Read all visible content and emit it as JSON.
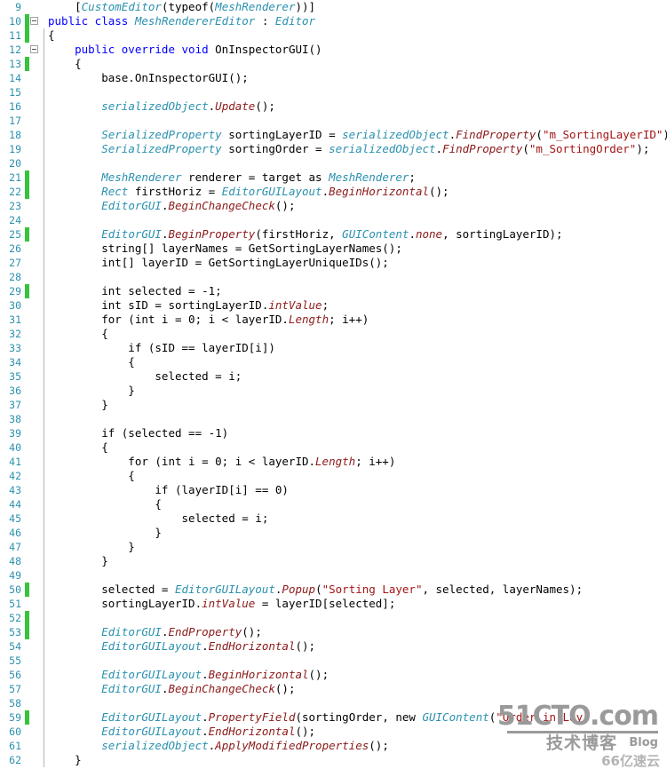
{
  "editor": {
    "language": "csharp",
    "first_line_number": 9,
    "colors": {
      "background": "#ffffff",
      "line_number": "#2b91af",
      "keyword": "#0000ff",
      "type": "#2b91af",
      "method": "#8b1a1a",
      "string": "#a31515",
      "plain": "#000000",
      "change_bar": "#36c43d",
      "indent_guide": "#b4b4b4"
    },
    "lines": [
      {
        "num": 9,
        "changed": false,
        "fold": "none",
        "guide": false,
        "tokens": [
          {
            "t": "    [",
            "c": "pln"
          },
          {
            "t": "CustomEditor",
            "c": "typ"
          },
          {
            "t": "(typeof(",
            "c": "pln"
          },
          {
            "t": "MeshRenderer",
            "c": "typ"
          },
          {
            "t": "))]",
            "c": "pln"
          }
        ]
      },
      {
        "num": 10,
        "changed": true,
        "fold": "open",
        "guide": false,
        "tokens": [
          {
            "t": "public class ",
            "c": "kw2"
          },
          {
            "t": "MeshRendererEditor",
            "c": "typ2"
          },
          {
            "t": " : ",
            "c": "pln"
          },
          {
            "t": "Editor",
            "c": "typ"
          }
        ]
      },
      {
        "num": 11,
        "changed": true,
        "fold": "none",
        "guide": true,
        "tokens": [
          {
            "t": "{",
            "c": "pln"
          }
        ]
      },
      {
        "num": 12,
        "changed": false,
        "fold": "open",
        "guide": true,
        "tokens": [
          {
            "t": "    public override void ",
            "c": "kw2"
          },
          {
            "t": "OnInspectorGUI()",
            "c": "pln2"
          }
        ]
      },
      {
        "num": 13,
        "changed": true,
        "fold": "none",
        "guide": true,
        "tokens": [
          {
            "t": "    {",
            "c": "pln"
          }
        ]
      },
      {
        "num": 14,
        "changed": false,
        "fold": "none",
        "guide": true,
        "tokens": [
          {
            "t": "        base.OnInspectorGUI();",
            "c": "pln"
          }
        ]
      },
      {
        "num": 15,
        "changed": false,
        "fold": "none",
        "guide": true,
        "tokens": []
      },
      {
        "num": 16,
        "changed": false,
        "fold": "none",
        "guide": true,
        "tokens": [
          {
            "t": "        ",
            "c": "pln"
          },
          {
            "t": "serializedObject",
            "c": "obj"
          },
          {
            "t": ".",
            "c": "pln"
          },
          {
            "t": "Update",
            "c": "mth"
          },
          {
            "t": "();",
            "c": "pln"
          }
        ]
      },
      {
        "num": 17,
        "changed": false,
        "fold": "none",
        "guide": true,
        "tokens": []
      },
      {
        "num": 18,
        "changed": false,
        "fold": "none",
        "guide": true,
        "tokens": [
          {
            "t": "        ",
            "c": "pln"
          },
          {
            "t": "SerializedProperty",
            "c": "typ"
          },
          {
            "t": " sortingLayerID = ",
            "c": "pln"
          },
          {
            "t": "serializedObject",
            "c": "obj"
          },
          {
            "t": ".",
            "c": "pln"
          },
          {
            "t": "FindProperty",
            "c": "mth"
          },
          {
            "t": "(",
            "c": "pln"
          },
          {
            "t": "\"m_SortingLayerID\"",
            "c": "str"
          },
          {
            "t": ");",
            "c": "pln"
          }
        ]
      },
      {
        "num": 19,
        "changed": false,
        "fold": "none",
        "guide": true,
        "tokens": [
          {
            "t": "        ",
            "c": "pln"
          },
          {
            "t": "SerializedProperty",
            "c": "typ"
          },
          {
            "t": " sortingOrder = ",
            "c": "pln"
          },
          {
            "t": "serializedObject",
            "c": "obj"
          },
          {
            "t": ".",
            "c": "pln"
          },
          {
            "t": "FindProperty",
            "c": "mth"
          },
          {
            "t": "(",
            "c": "pln"
          },
          {
            "t": "\"m_SortingOrder\"",
            "c": "str"
          },
          {
            "t": ");",
            "c": "pln"
          }
        ]
      },
      {
        "num": 20,
        "changed": false,
        "fold": "none",
        "guide": true,
        "tokens": []
      },
      {
        "num": 21,
        "changed": true,
        "fold": "none",
        "guide": true,
        "tokens": [
          {
            "t": "        ",
            "c": "pln"
          },
          {
            "t": "MeshRenderer",
            "c": "typ"
          },
          {
            "t": " renderer = target as ",
            "c": "pln"
          },
          {
            "t": "MeshRenderer",
            "c": "typ"
          },
          {
            "t": ";",
            "c": "pln"
          }
        ]
      },
      {
        "num": 22,
        "changed": true,
        "fold": "none",
        "guide": true,
        "tokens": [
          {
            "t": "        ",
            "c": "pln"
          },
          {
            "t": "Rect",
            "c": "typ"
          },
          {
            "t": " firstHoriz = ",
            "c": "pln"
          },
          {
            "t": "EditorGUILayout",
            "c": "typ"
          },
          {
            "t": ".",
            "c": "pln"
          },
          {
            "t": "BeginHorizontal",
            "c": "mth"
          },
          {
            "t": "();",
            "c": "pln"
          }
        ]
      },
      {
        "num": 23,
        "changed": false,
        "fold": "none",
        "guide": true,
        "tokens": [
          {
            "t": "        ",
            "c": "pln"
          },
          {
            "t": "EditorGUI",
            "c": "typ"
          },
          {
            "t": ".",
            "c": "pln"
          },
          {
            "t": "BeginChangeCheck",
            "c": "mth"
          },
          {
            "t": "();",
            "c": "pln"
          }
        ]
      },
      {
        "num": 24,
        "changed": false,
        "fold": "none",
        "guide": true,
        "tokens": []
      },
      {
        "num": 25,
        "changed": true,
        "fold": "none",
        "guide": true,
        "tokens": [
          {
            "t": "        ",
            "c": "pln"
          },
          {
            "t": "EditorGUI",
            "c": "typ"
          },
          {
            "t": ".",
            "c": "pln"
          },
          {
            "t": "BeginProperty",
            "c": "mth"
          },
          {
            "t": "(firstHoriz, ",
            "c": "pln"
          },
          {
            "t": "GUIContent",
            "c": "typ"
          },
          {
            "t": ".",
            "c": "pln"
          },
          {
            "t": "none",
            "c": "mth"
          },
          {
            "t": ", sortingLayerID);",
            "c": "pln"
          }
        ]
      },
      {
        "num": 26,
        "changed": false,
        "fold": "none",
        "guide": true,
        "tokens": [
          {
            "t": "        string[] layerNames = GetSortingLayerNames();",
            "c": "pln"
          }
        ]
      },
      {
        "num": 27,
        "changed": false,
        "fold": "none",
        "guide": true,
        "tokens": [
          {
            "t": "        int[] layerID = GetSortingLayerUniqueIDs();",
            "c": "pln"
          }
        ]
      },
      {
        "num": 28,
        "changed": false,
        "fold": "none",
        "guide": true,
        "tokens": []
      },
      {
        "num": 29,
        "changed": true,
        "fold": "none",
        "guide": true,
        "tokens": [
          {
            "t": "        int selected = -1;",
            "c": "pln"
          }
        ]
      },
      {
        "num": 30,
        "changed": false,
        "fold": "none",
        "guide": true,
        "tokens": [
          {
            "t": "        int sID = sortingLayerID.",
            "c": "pln"
          },
          {
            "t": "intValue",
            "c": "mth"
          },
          {
            "t": ";",
            "c": "pln"
          }
        ]
      },
      {
        "num": 31,
        "changed": false,
        "fold": "none",
        "guide": true,
        "tokens": [
          {
            "t": "        for (int i = 0; i < layerID.",
            "c": "pln"
          },
          {
            "t": "Length",
            "c": "mth"
          },
          {
            "t": "; i++)",
            "c": "pln"
          }
        ]
      },
      {
        "num": 32,
        "changed": false,
        "fold": "none",
        "guide": true,
        "tokens": [
          {
            "t": "        {",
            "c": "pln"
          }
        ]
      },
      {
        "num": 33,
        "changed": false,
        "fold": "none",
        "guide": true,
        "tokens": [
          {
            "t": "            if (sID == layerID[i])",
            "c": "pln"
          }
        ]
      },
      {
        "num": 34,
        "changed": false,
        "fold": "none",
        "guide": true,
        "tokens": [
          {
            "t": "            {",
            "c": "pln"
          }
        ]
      },
      {
        "num": 35,
        "changed": false,
        "fold": "none",
        "guide": true,
        "tokens": [
          {
            "t": "                selected = i;",
            "c": "pln"
          }
        ]
      },
      {
        "num": 36,
        "changed": false,
        "fold": "none",
        "guide": true,
        "tokens": [
          {
            "t": "            }",
            "c": "pln"
          }
        ]
      },
      {
        "num": 37,
        "changed": false,
        "fold": "none",
        "guide": true,
        "tokens": [
          {
            "t": "        }",
            "c": "pln"
          }
        ]
      },
      {
        "num": 38,
        "changed": false,
        "fold": "none",
        "guide": true,
        "tokens": []
      },
      {
        "num": 39,
        "changed": false,
        "fold": "none",
        "guide": true,
        "tokens": [
          {
            "t": "        if (selected == -1)",
            "c": "pln"
          }
        ]
      },
      {
        "num": 40,
        "changed": false,
        "fold": "none",
        "guide": true,
        "tokens": [
          {
            "t": "        {",
            "c": "pln"
          }
        ]
      },
      {
        "num": 41,
        "changed": false,
        "fold": "none",
        "guide": true,
        "tokens": [
          {
            "t": "            for (int i = 0; i < layerID.",
            "c": "pln"
          },
          {
            "t": "Length",
            "c": "mth"
          },
          {
            "t": "; i++)",
            "c": "pln"
          }
        ]
      },
      {
        "num": 42,
        "changed": false,
        "fold": "none",
        "guide": true,
        "tokens": [
          {
            "t": "            {",
            "c": "pln"
          }
        ]
      },
      {
        "num": 43,
        "changed": false,
        "fold": "none",
        "guide": true,
        "tokens": [
          {
            "t": "                if (layerID[i] == 0)",
            "c": "pln"
          }
        ]
      },
      {
        "num": 44,
        "changed": false,
        "fold": "none",
        "guide": true,
        "tokens": [
          {
            "t": "                {",
            "c": "pln"
          }
        ]
      },
      {
        "num": 45,
        "changed": false,
        "fold": "none",
        "guide": true,
        "tokens": [
          {
            "t": "                    selected = i;",
            "c": "pln"
          }
        ]
      },
      {
        "num": 46,
        "changed": false,
        "fold": "none",
        "guide": true,
        "tokens": [
          {
            "t": "                }",
            "c": "pln"
          }
        ]
      },
      {
        "num": 47,
        "changed": false,
        "fold": "none",
        "guide": true,
        "tokens": [
          {
            "t": "            }",
            "c": "pln"
          }
        ]
      },
      {
        "num": 48,
        "changed": false,
        "fold": "none",
        "guide": true,
        "tokens": [
          {
            "t": "        }",
            "c": "pln"
          }
        ]
      },
      {
        "num": 49,
        "changed": false,
        "fold": "none",
        "guide": true,
        "tokens": []
      },
      {
        "num": 50,
        "changed": true,
        "fold": "none",
        "guide": true,
        "tokens": [
          {
            "t": "        selected = ",
            "c": "pln"
          },
          {
            "t": "EditorGUILayout",
            "c": "typ"
          },
          {
            "t": ".",
            "c": "pln"
          },
          {
            "t": "Popup",
            "c": "mth"
          },
          {
            "t": "(",
            "c": "pln"
          },
          {
            "t": "\"Sorting Layer\"",
            "c": "str"
          },
          {
            "t": ", selected, layerNames);",
            "c": "pln"
          }
        ]
      },
      {
        "num": 51,
        "changed": false,
        "fold": "none",
        "guide": true,
        "tokens": [
          {
            "t": "        sortingLayerID.",
            "c": "pln"
          },
          {
            "t": "intValue",
            "c": "mth"
          },
          {
            "t": " = layerID[selected];",
            "c": "pln"
          }
        ]
      },
      {
        "num": 52,
        "changed": true,
        "fold": "none",
        "guide": true,
        "tokens": []
      },
      {
        "num": 53,
        "changed": true,
        "fold": "none",
        "guide": true,
        "tokens": [
          {
            "t": "        ",
            "c": "pln"
          },
          {
            "t": "EditorGUI",
            "c": "typ"
          },
          {
            "t": ".",
            "c": "pln"
          },
          {
            "t": "EndProperty",
            "c": "mth"
          },
          {
            "t": "();",
            "c": "pln"
          }
        ]
      },
      {
        "num": 54,
        "changed": false,
        "fold": "none",
        "guide": true,
        "tokens": [
          {
            "t": "        ",
            "c": "pln"
          },
          {
            "t": "EditorGUILayout",
            "c": "typ"
          },
          {
            "t": ".",
            "c": "pln"
          },
          {
            "t": "EndHorizontal",
            "c": "mth"
          },
          {
            "t": "();",
            "c": "pln"
          }
        ]
      },
      {
        "num": 55,
        "changed": false,
        "fold": "none",
        "guide": true,
        "tokens": []
      },
      {
        "num": 56,
        "changed": false,
        "fold": "none",
        "guide": true,
        "tokens": [
          {
            "t": "        ",
            "c": "pln"
          },
          {
            "t": "EditorGUILayout",
            "c": "typ"
          },
          {
            "t": ".",
            "c": "pln"
          },
          {
            "t": "BeginHorizontal",
            "c": "mth"
          },
          {
            "t": "();",
            "c": "pln"
          }
        ]
      },
      {
        "num": 57,
        "changed": false,
        "fold": "none",
        "guide": true,
        "tokens": [
          {
            "t": "        ",
            "c": "pln"
          },
          {
            "t": "EditorGUI",
            "c": "typ"
          },
          {
            "t": ".",
            "c": "pln"
          },
          {
            "t": "BeginChangeCheck",
            "c": "mth"
          },
          {
            "t": "();",
            "c": "pln"
          }
        ]
      },
      {
        "num": 58,
        "changed": false,
        "fold": "none",
        "guide": true,
        "tokens": []
      },
      {
        "num": 59,
        "changed": true,
        "fold": "none",
        "guide": true,
        "tokens": [
          {
            "t": "        ",
            "c": "pln"
          },
          {
            "t": "EditorGUILayout",
            "c": "typ"
          },
          {
            "t": ".",
            "c": "pln"
          },
          {
            "t": "PropertyField",
            "c": "mth"
          },
          {
            "t": "(sortingOrder, new ",
            "c": "pln"
          },
          {
            "t": "GUIContent",
            "c": "typ"
          },
          {
            "t": "(",
            "c": "pln"
          },
          {
            "t": "\"Order in Lay",
            "c": "str"
          }
        ]
      },
      {
        "num": 60,
        "changed": false,
        "fold": "none",
        "guide": true,
        "tokens": [
          {
            "t": "        ",
            "c": "pln"
          },
          {
            "t": "EditorGUILayout",
            "c": "typ"
          },
          {
            "t": ".",
            "c": "pln"
          },
          {
            "t": "EndHorizontal",
            "c": "mth"
          },
          {
            "t": "();",
            "c": "pln"
          }
        ]
      },
      {
        "num": 61,
        "changed": false,
        "fold": "none",
        "guide": true,
        "tokens": [
          {
            "t": "        ",
            "c": "pln"
          },
          {
            "t": "serializedObject",
            "c": "obj"
          },
          {
            "t": ".",
            "c": "pln"
          },
          {
            "t": "ApplyModifiedProperties",
            "c": "mth"
          },
          {
            "t": "();",
            "c": "pln"
          }
        ]
      },
      {
        "num": 62,
        "changed": false,
        "fold": "none",
        "guide": true,
        "tokens": [
          {
            "t": "    }",
            "c": "pln"
          }
        ]
      }
    ]
  },
  "watermark": {
    "main": "51CTO.com",
    "chinese": "技术博客",
    "blog": "Blog",
    "yun": "亿速云",
    "yun_icon": "66"
  }
}
